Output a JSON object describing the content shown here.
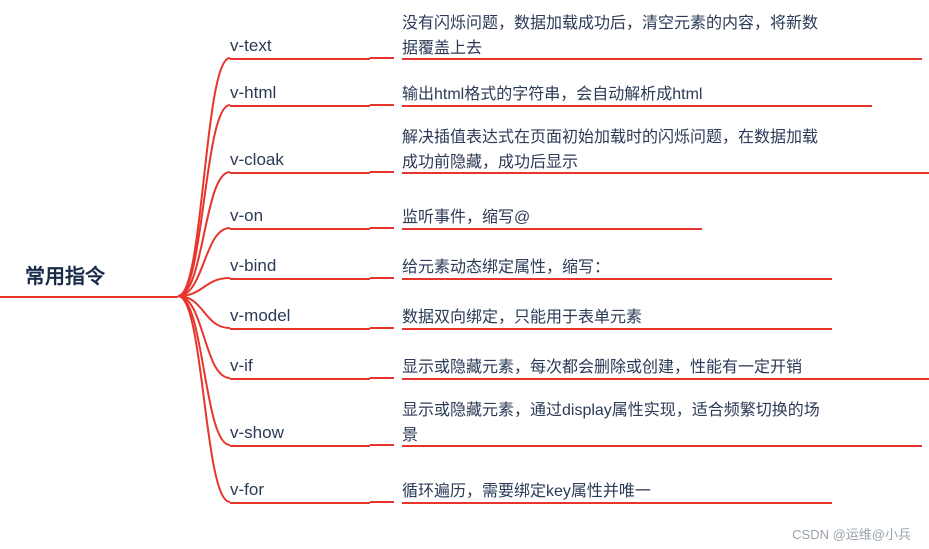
{
  "root": "常用指令",
  "branches": [
    {
      "name": "v-text",
      "desc": "没有闪烁问题，数据加载成功后，清空元素的内容，将新数据覆盖上去",
      "multiline": true
    },
    {
      "name": "v-html",
      "desc": "输出html格式的字符串，会自动解析成html",
      "multiline": false
    },
    {
      "name": "v-cloak",
      "desc": "解决插值表达式在页面初始加载时的闪烁问题，在数据加载成功前隐藏，成功后显示",
      "multiline": true
    },
    {
      "name": "v-on",
      "desc": "监听事件，缩写@",
      "multiline": false
    },
    {
      "name": "v-bind",
      "desc": "给元素动态绑定属性，缩写：",
      "multiline": false
    },
    {
      "name": "v-model",
      "desc": "数据双向绑定，只能用于表单元素",
      "multiline": false
    },
    {
      "name": "v-if",
      "desc": "显示或隐藏元素，每次都会删除或创建，性能有一定开销",
      "multiline": false
    },
    {
      "name": "v-show",
      "desc": "显示或隐藏元素，通过display属性实现，适合频繁切换的场景",
      "multiline": true
    },
    {
      "name": "v-for",
      "desc": "循环遍历，需要绑定key属性并唯一",
      "multiline": false
    }
  ],
  "watermark": "CSDN @运维@小兵",
  "colors": {
    "line": "#e7352c",
    "text": "#2b3a55"
  },
  "layout": {
    "rootY": 296,
    "dirW": 140,
    "descX": 172,
    "rowYs": [
      58,
      105,
      172,
      228,
      278,
      328,
      378,
      445,
      502
    ],
    "dirUnderlineWs": [
      140,
      140,
      140,
      140,
      140,
      140,
      140,
      140,
      140
    ],
    "descUnderlineWs": [
      520,
      470,
      700,
      300,
      430,
      430,
      570,
      520,
      430
    ]
  }
}
